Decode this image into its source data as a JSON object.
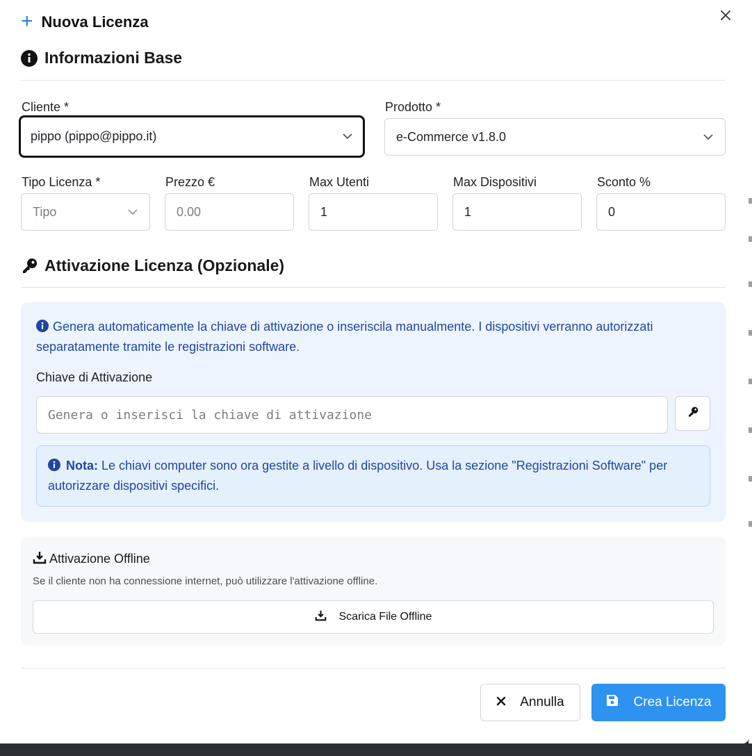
{
  "modal": {
    "title": "Nuova Licenza",
    "close_icon": "close-icon"
  },
  "section_base": {
    "title": "Informazioni Base",
    "icon": "info-circle-icon"
  },
  "fields": {
    "cliente": {
      "label": "Cliente *",
      "value": "pippo (pippo@pippo.it)"
    },
    "prodotto": {
      "label": "Prodotto *",
      "value": "e-Commerce v1.8.0"
    },
    "tipo_licenza": {
      "label": "Tipo Licenza *",
      "placeholder": "Tipo"
    },
    "prezzo": {
      "label": "Prezzo €",
      "placeholder": "0.00"
    },
    "max_utenti": {
      "label": "Max Utenti",
      "value": "1"
    },
    "max_dispositivi": {
      "label": "Max Dispositivi",
      "value": "1"
    },
    "sconto": {
      "label": "Sconto %",
      "value": "0"
    }
  },
  "section_activation": {
    "title": "Attivazione Licenza (Opzionale)",
    "icon": "key-icon",
    "info": "Genera automaticamente la chiave di attivazione o inseriscila manualmente. I dispositivi verranno autorizzati separatamente tramite le registrazioni software.",
    "key_label": "Chiave di Attivazione",
    "key_placeholder": "Genera o inserisci la chiave di attivazione",
    "note_bold": "Nota:",
    "note_text": "Le chiavi computer sono ora gestite a livello di dispositivo. Usa la sezione \"Registrazioni Software\" per autorizzare dispositivi specifici."
  },
  "offline": {
    "title": "Attivazione Offline",
    "description": "Se il cliente non ha connessione internet, può utilizzare l'attivazione offline.",
    "button_label": "Scarica File Offline"
  },
  "footer": {
    "cancel_label": "Annulla",
    "create_label": "Crea Licenza"
  },
  "colors": {
    "accent": "#2d92f0",
    "info_text": "#1f47a0",
    "info_bg": "#edf4fe"
  }
}
